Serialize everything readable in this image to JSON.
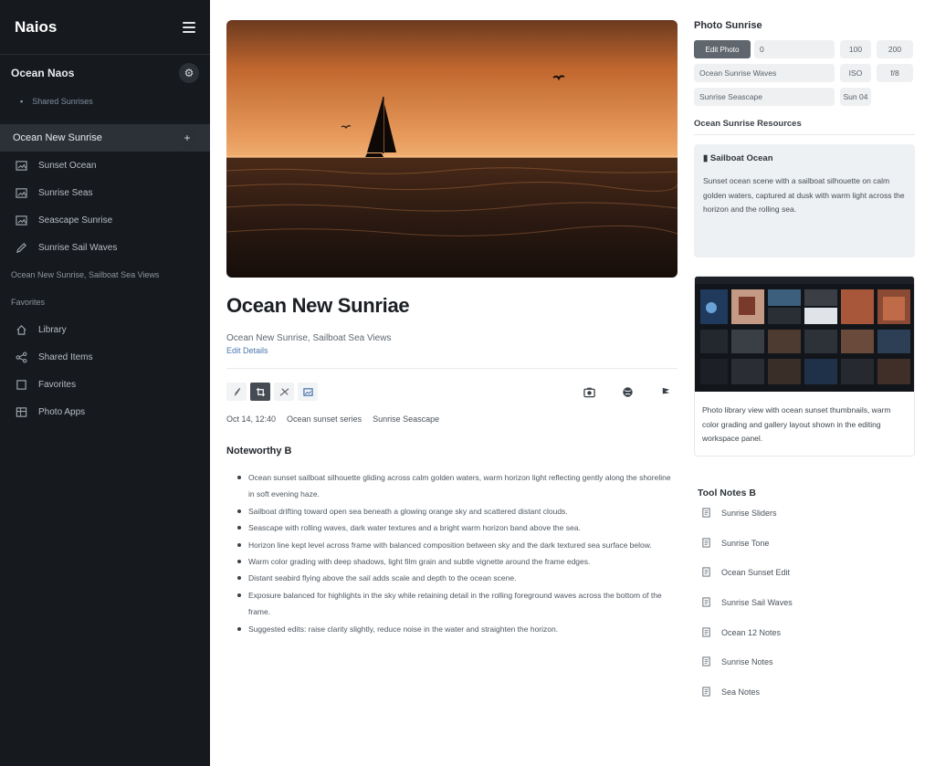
{
  "sidebar": {
    "title": "Naios",
    "section_label": "Ocean Naos",
    "section_sub": "Shared Sunrises",
    "active_label": "Ocean New Sunrise",
    "items": [
      {
        "label": "Sunset Ocean",
        "icon": "image-icon"
      },
      {
        "label": "Sunrise Seas",
        "icon": "image-icon"
      },
      {
        "label": "Seascape Sunrise",
        "icon": "image-icon"
      },
      {
        "label": "Sunrise Sail Waves",
        "icon": "edit-icon"
      }
    ],
    "group_label": "Ocean New Sunrise, Sailboat Sea Views",
    "group2_label": "Favorites",
    "items2": [
      {
        "label": "Library",
        "icon": "home-icon"
      },
      {
        "label": "Shared Items",
        "icon": "share-icon"
      },
      {
        "label": "Favorites",
        "icon": "square-icon"
      },
      {
        "label": "Photo Apps",
        "icon": "grid-icon"
      }
    ]
  },
  "main": {
    "title": "Ocean New Sunriae",
    "meta": "Ocean New Sunrise, Sailboat Sea Views",
    "meta_link": "Edit Details",
    "stats": [
      "Oct 14, 12:40",
      "Ocean sunset series",
      "Sunrise Seascape"
    ],
    "notes_heading": "Noteworthy B",
    "notes": [
      "Ocean sunset sailboat silhouette gliding across calm golden waters, warm horizon light reflecting gently along the shoreline in soft evening haze.",
      "Sailboat drifting toward open sea beneath a glowing orange sky and scattered distant clouds.",
      "Seascape with rolling waves, dark water textures and a bright warm horizon band above the sea.",
      "Horizon line kept level across frame with balanced composition between sky and the dark textured sea surface below.",
      "Warm color grading with deep shadows, light film grain and subtle vignette around the frame edges.",
      "Distant seabird flying above the sail adds scale and depth to the ocean scene.",
      "Exposure balanced for highlights in the sky while retaining detail in the rolling foreground waves across the bottom of the frame.",
      "Suggested edits: raise clarity slightly, reduce noise in the water and straighten the horizon."
    ]
  },
  "panel": {
    "heading": "Photo Sunrise",
    "grid": {
      "r1_dark": "Edit Photo",
      "r1_field": "0",
      "r1_b1": "100",
      "r1_b2": "200",
      "r2_field": "Ocean Sunrise Waves",
      "r2_b1": "ISO",
      "r2_b2": "f/8",
      "r3_field": "Sunrise Seascape",
      "r3_b1": "Sun 04"
    },
    "resources_heading": "Ocean Sunrise Resources",
    "info_heading": "Sailboat Ocean",
    "info_text": "Sunset ocean scene with a sailboat silhouette on calm golden waters, captured at dusk with warm light across the horizon and the rolling sea.",
    "card_text": "Photo library view with ocean sunset thumbnails, warm color grading and gallery layout shown in the editing workspace panel.",
    "tools_heading": "Tool Notes B",
    "tools": [
      {
        "label": "Sunrise Sliders",
        "icon": "doc-icon"
      },
      {
        "label": "Sunrise Tone",
        "icon": "doc-icon"
      },
      {
        "label": "Ocean Sunset Edit",
        "icon": "doc-icon"
      },
      {
        "label": "Sunrise Sail Waves",
        "icon": "doc-icon"
      },
      {
        "label": "Ocean 12 Notes",
        "icon": "doc-icon"
      },
      {
        "label": "Sunrise Notes",
        "icon": "doc-icon"
      },
      {
        "label": "Sea Notes",
        "icon": "doc-icon"
      }
    ]
  },
  "colors": {
    "sidebar_bg": "#16191d",
    "sky_top": "#c86d33",
    "sky_bottom": "#e39658",
    "sea": "#2a1b14"
  }
}
